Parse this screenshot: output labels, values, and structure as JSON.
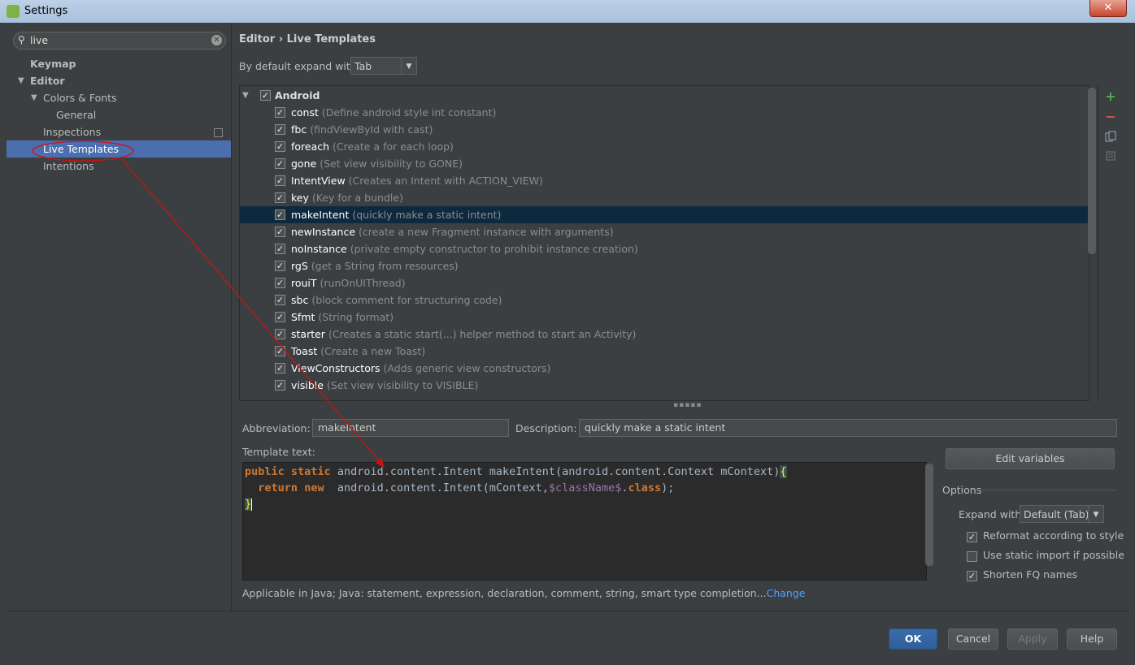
{
  "window": {
    "title": "Settings",
    "close_label": "✕"
  },
  "search": {
    "query": "live"
  },
  "nav": {
    "keymap": "Keymap",
    "editor": "Editor",
    "colors_fonts": "Colors & Fonts",
    "general": "General",
    "inspections": "Inspections",
    "live_templates": "Live Templates",
    "intentions": "Intentions"
  },
  "breadcrumb": {
    "parent": "Editor",
    "separator": "›",
    "current": "Live Templates"
  },
  "expand": {
    "label": "By default expand with",
    "value": "Tab"
  },
  "tree": {
    "group": "Android",
    "templates": [
      {
        "name": "const",
        "desc": "(Define android style int constant)"
      },
      {
        "name": "fbc",
        "desc": "(findViewById with cast)"
      },
      {
        "name": "foreach",
        "desc": "(Create a for each loop)"
      },
      {
        "name": "gone",
        "desc": "(Set view visibility to GONE)"
      },
      {
        "name": "IntentView",
        "desc": "(Creates an Intent with ACTION_VIEW)"
      },
      {
        "name": "key",
        "desc": "(Key for a bundle)"
      },
      {
        "name": "makeIntent",
        "desc": "(quickly make a static intent)"
      },
      {
        "name": "newInstance",
        "desc": "(create a new Fragment instance with arguments)"
      },
      {
        "name": "noInstance",
        "desc": "(private empty constructor to prohibit instance creation)"
      },
      {
        "name": "rgS",
        "desc": "(get a String from resources)"
      },
      {
        "name": "rouiT",
        "desc": "(runOnUIThread)"
      },
      {
        "name": "sbc",
        "desc": "(block comment for structuring code)"
      },
      {
        "name": "Sfmt",
        "desc": "(String format)"
      },
      {
        "name": "starter",
        "desc": "(Creates a static start(...) helper method to start an Activity)"
      },
      {
        "name": "Toast",
        "desc": "(Create a new Toast)"
      },
      {
        "name": "ViewConstructors",
        "desc": "(Adds generic view constructors)"
      },
      {
        "name": "visible",
        "desc": "(Set view visibility to VISIBLE)"
      }
    ],
    "selected_index": 6
  },
  "abbreviation": {
    "label": "Abbreviation:",
    "value": "makeIntent"
  },
  "description": {
    "label": "Description:",
    "value": "quickly make a static intent"
  },
  "template_text": {
    "label": "Template text:",
    "line1": {
      "kw1": "public",
      "kw2": "static",
      "rest": " android.content.Intent makeIntent(android.content.Context mContext)",
      "brace": "{"
    },
    "line2": {
      "kw1": "return",
      "kw2": "new",
      "pre": "  android.content.Intent(mContext,",
      "var": "$className$",
      "dot": ".",
      "kw3": "class",
      "end": ");"
    },
    "line3": {
      "brace": "}"
    }
  },
  "edit_variables": "Edit variables",
  "options": {
    "title": "Options",
    "expand_with_label": "Expand with",
    "expand_with_value": "Default (Tab)",
    "reformat": {
      "label": "Reformat according to style",
      "checked": true
    },
    "static_import": {
      "label": "Use static import if possible",
      "checked": false
    },
    "shorten_fq": {
      "label": "Shorten FQ names",
      "checked": true
    }
  },
  "applicable": {
    "text": "Applicable in Java; Java: statement, expression, declaration, comment, string, smart type completion...",
    "link": "Change"
  },
  "buttons": {
    "ok": "OK",
    "cancel": "Cancel",
    "apply": "Apply",
    "help": "Help"
  },
  "tools": {
    "add": "+",
    "remove": "−"
  },
  "colors": {
    "selection": "#4b6eaf",
    "tree_selection": "#0d293e",
    "annotation": "#d01010",
    "link": "#589df6"
  }
}
